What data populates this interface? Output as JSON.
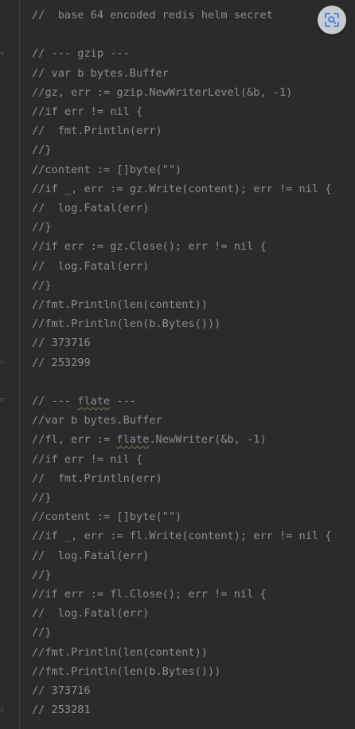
{
  "editor": {
    "lines": [
      "//  base 64 encoded redis helm secret",
      "",
      "// --- gzip ---",
      "// var b bytes.Buffer",
      "//gz, err := gzip.NewWriterLevel(&b, -1)",
      "//if err != nil {",
      "//  fmt.Println(err)",
      "//}",
      "//content := []byte(\"\")",
      "//if _, err := gz.Write(content); err != nil {",
      "//  log.Fatal(err)",
      "//}",
      "//if err := gz.Close(); err != nil {",
      "//  log.Fatal(err)",
      "//}",
      "//fmt.Println(len(content))",
      "//fmt.Println(len(b.Bytes()))",
      "// 373716",
      "// 253299",
      "",
      "// --- flate ---",
      "//var b bytes.Buffer",
      "//fl, err := flate.NewWriter(&b, -1)",
      "//if err != nil {",
      "//  fmt.Println(err)",
      "//}",
      "//content := []byte(\"\")",
      "//if _, err := fl.Write(content); err != nil {",
      "//  log.Fatal(err)",
      "//}",
      "//if err := fl.Close(); err != nil {",
      "//  log.Fatal(err)",
      "//}",
      "//fmt.Println(len(content))",
      "//fmt.Println(len(b.Bytes()))",
      "// 373716",
      "// 253281"
    ]
  },
  "overlay": {
    "scan_button_icon": "screen-scan-icon"
  },
  "colors": {
    "background": "#2b2b2b",
    "comment_text": "#8a8d90",
    "scan_button_bg": "#c7ccd3",
    "scan_button_icon": "#3d7be0"
  }
}
